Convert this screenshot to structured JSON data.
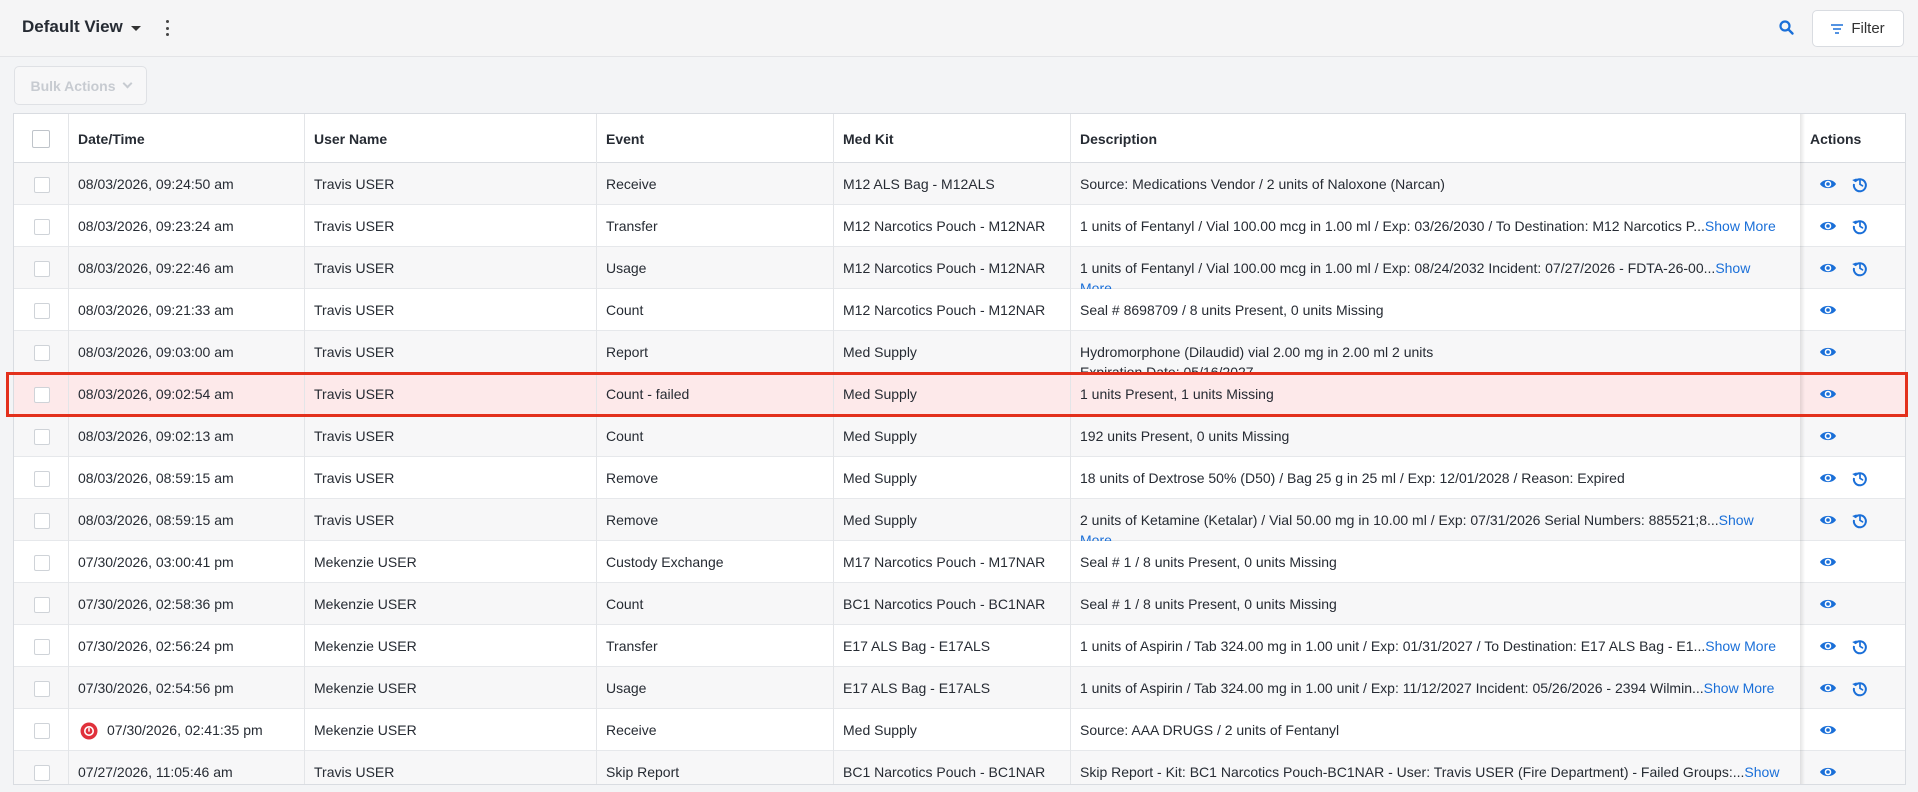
{
  "header": {
    "view_title": "Default View",
    "filter_label": "Filter",
    "bulk_actions_label": "Bulk Actions"
  },
  "columns": {
    "datetime": "Date/Time",
    "user": "User Name",
    "event": "Event",
    "medkit": "Med Kit",
    "description": "Description",
    "actions": "Actions"
  },
  "rows": [
    {
      "datetime": "08/03/2026, 09:24:50 am",
      "user": "Travis USER",
      "event": "Receive",
      "medkit": "M12 ALS Bag - M12ALS",
      "description": "Source: Medications Vendor / 2 units of Naloxone (Narcan)",
      "desc_line2": "",
      "show_more": "",
      "restore": true,
      "alert": false
    },
    {
      "datetime": "08/03/2026, 09:23:24 am",
      "user": "Travis USER",
      "event": "Transfer",
      "medkit": "M12 Narcotics Pouch - M12NAR",
      "description": "1 units of Fentanyl / Vial 100.00 mcg in 1.00 ml / Exp: 03/26/2030 / To Destination: M12 Narcotics P...",
      "desc_line2": "",
      "show_more": "Show More",
      "restore": true,
      "alert": false
    },
    {
      "datetime": "08/03/2026, 09:22:46 am",
      "user": "Travis USER",
      "event": "Usage",
      "medkit": "M12 Narcotics Pouch - M12NAR",
      "description": "1 units of Fentanyl / Vial 100.00 mcg in 1.00 ml / Exp: 08/24/2032 Incident: 07/27/2026 - FDTA-26-00...",
      "desc_line2": "More",
      "show_more": "Show",
      "restore": true,
      "alert": false
    },
    {
      "datetime": "08/03/2026, 09:21:33 am",
      "user": "Travis USER",
      "event": "Count",
      "medkit": "M12 Narcotics Pouch - M12NAR",
      "description": "Seal # 8698709 / 8 units Present, 0 units Missing",
      "desc_line2": "",
      "show_more": "",
      "restore": false,
      "alert": false
    },
    {
      "datetime": "08/03/2026, 09:03:00 am",
      "user": "Travis USER",
      "event": "Report",
      "medkit": "Med Supply",
      "description": "Hydromorphone (Dilaudid) vial 2.00 mg in 2.00 ml 2 units",
      "desc_line2": "Expiration Date: 05/16/2027",
      "show_more": "",
      "restore": false,
      "alert": false
    },
    {
      "datetime": "08/03/2026, 09:02:54 am",
      "user": "Travis USER",
      "event": "Count - failed",
      "medkit": "Med Supply",
      "description": "1 units Present, 1 units Missing",
      "desc_line2": "",
      "show_more": "",
      "restore": false,
      "alert": false,
      "highlight": true
    },
    {
      "datetime": "08/03/2026, 09:02:13 am",
      "user": "Travis USER",
      "event": "Count",
      "medkit": "Med Supply",
      "description": "192 units Present, 0 units Missing",
      "desc_line2": "",
      "show_more": "",
      "restore": false,
      "alert": false
    },
    {
      "datetime": "08/03/2026, 08:59:15 am",
      "user": "Travis USER",
      "event": "Remove",
      "medkit": "Med Supply",
      "description": "18 units of Dextrose 50% (D50) / Bag 25 g in 25 ml / Exp: 12/01/2028 / Reason: Expired",
      "desc_line2": "",
      "show_more": "",
      "restore": true,
      "alert": false
    },
    {
      "datetime": "08/03/2026, 08:59:15 am",
      "user": "Travis USER",
      "event": "Remove",
      "medkit": "Med Supply",
      "description": "2 units of Ketamine (Ketalar) / Vial 50.00 mg in 10.00 ml / Exp: 07/31/2026 Serial Numbers: 885521;8...",
      "desc_line2": "More",
      "show_more": "Show",
      "restore": true,
      "alert": false
    },
    {
      "datetime": "07/30/2026, 03:00:41 pm",
      "user": "Mekenzie USER",
      "event": "Custody Exchange",
      "medkit": "M17 Narcotics Pouch - M17NAR",
      "description": "Seal # 1 / 8 units Present, 0 units Missing",
      "desc_line2": "",
      "show_more": "",
      "restore": false,
      "alert": false
    },
    {
      "datetime": "07/30/2026, 02:58:36 pm",
      "user": "Mekenzie USER",
      "event": "Count",
      "medkit": "BC1 Narcotics Pouch - BC1NAR",
      "description": "Seal # 1 / 8 units Present, 0 units Missing",
      "desc_line2": "",
      "show_more": "",
      "restore": false,
      "alert": false
    },
    {
      "datetime": "07/30/2026, 02:56:24 pm",
      "user": "Mekenzie USER",
      "event": "Transfer",
      "medkit": "E17 ALS Bag - E17ALS",
      "description": "1 units of Aspirin / Tab 324.00 mg in 1.00 unit / Exp: 01/31/2027 / To Destination: E17 ALS Bag - E1...",
      "desc_line2": "",
      "show_more": "Show More",
      "restore": true,
      "alert": false
    },
    {
      "datetime": "07/30/2026, 02:54:56 pm",
      "user": "Mekenzie USER",
      "event": "Usage",
      "medkit": "E17 ALS Bag - E17ALS",
      "description": "1 units of Aspirin / Tab 324.00 mg in 1.00 unit / Exp: 11/12/2027 Incident: 05/26/2026 - 2394 Wilmin...",
      "desc_line2": "",
      "show_more": "Show More",
      "restore": true,
      "alert": false
    },
    {
      "datetime": "07/30/2026, 02:41:35 pm",
      "user": "Mekenzie USER",
      "event": "Receive",
      "medkit": "Med Supply",
      "description": "Source: AAA DRUGS / 2 units of Fentanyl",
      "desc_line2": "",
      "show_more": "",
      "restore": false,
      "alert": true
    },
    {
      "datetime": "07/27/2026, 11:05:46 am",
      "user": "Travis USER",
      "event": "Skip Report",
      "medkit": "BC1 Narcotics Pouch - BC1NAR",
      "description": "Skip Report - Kit: BC1 Narcotics Pouch-BC1NAR - User: Travis USER (Fire Department) - Failed Groups:...",
      "desc_line2": "",
      "show_more": "Show",
      "restore": false,
      "alert": false
    }
  ],
  "colors": {
    "accent": "#1a6fd8",
    "highlight_border": "#e3301c",
    "highlight_row": "#fde9ea",
    "alert": "#e0313b"
  }
}
